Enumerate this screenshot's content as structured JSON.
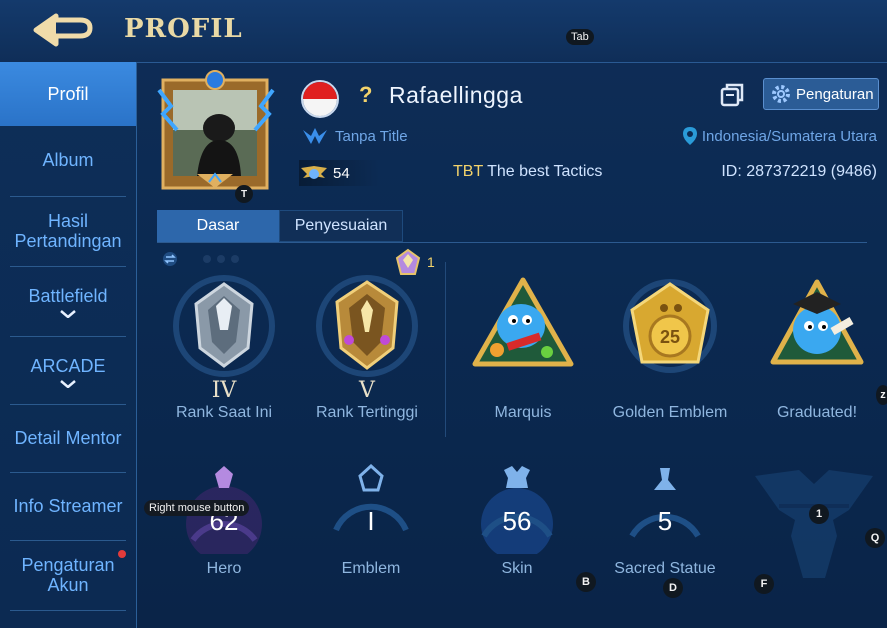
{
  "header": {
    "title": "PROFIL"
  },
  "hints": {
    "tab": "Tab",
    "avatar_key": "T",
    "right_mouse": "Right mouse button",
    "key_1": "1",
    "key_q": "Q",
    "key_b": "B",
    "key_d": "D",
    "key_f": "F",
    "key_z": "z"
  },
  "sidebar": {
    "items": [
      {
        "label": "Profil",
        "active": true
      },
      {
        "label": "Album"
      },
      {
        "label": "Hasil Pertandingan"
      },
      {
        "label": "Battlefield"
      },
      {
        "label": "ARCADE"
      },
      {
        "label": "Detail Mentor"
      },
      {
        "label": "Info Streamer"
      },
      {
        "label": "Pengaturan Akun"
      }
    ]
  },
  "profile": {
    "question_mark": "?",
    "name": "Rafaellingga",
    "title": "Tanpa Title",
    "location": "Indonesia/Sumatera Utara",
    "level": "54",
    "squad_tag": "TBT",
    "squad_name": "The best Tactics",
    "id": "ID: 287372219 (9486)",
    "settings_label": "Pengaturan"
  },
  "tabs": [
    {
      "label": "Dasar",
      "active": true
    },
    {
      "label": "Penyesuaian"
    }
  ],
  "season_badge_count": "1",
  "achievements": [
    {
      "roman": "IV",
      "label": "Rank Saat Ini"
    },
    {
      "roman": "V",
      "label": "Rank Tertinggi"
    },
    {
      "roman": "",
      "label": "Marquis"
    },
    {
      "roman": "",
      "label": "Golden Emblem",
      "badge_number": "25"
    },
    {
      "roman": "",
      "label": "Graduated!"
    }
  ],
  "stats": [
    {
      "label": "Hero",
      "value": "62"
    },
    {
      "label": "Emblem",
      "value": "I"
    },
    {
      "label": "Skin",
      "value": "56"
    },
    {
      "label": "Sacred Statue",
      "value": "5"
    }
  ],
  "colors": {
    "gold": "#f3d36b",
    "accent_blue": "#2d67ab",
    "link_blue": "#6fb4ff"
  }
}
